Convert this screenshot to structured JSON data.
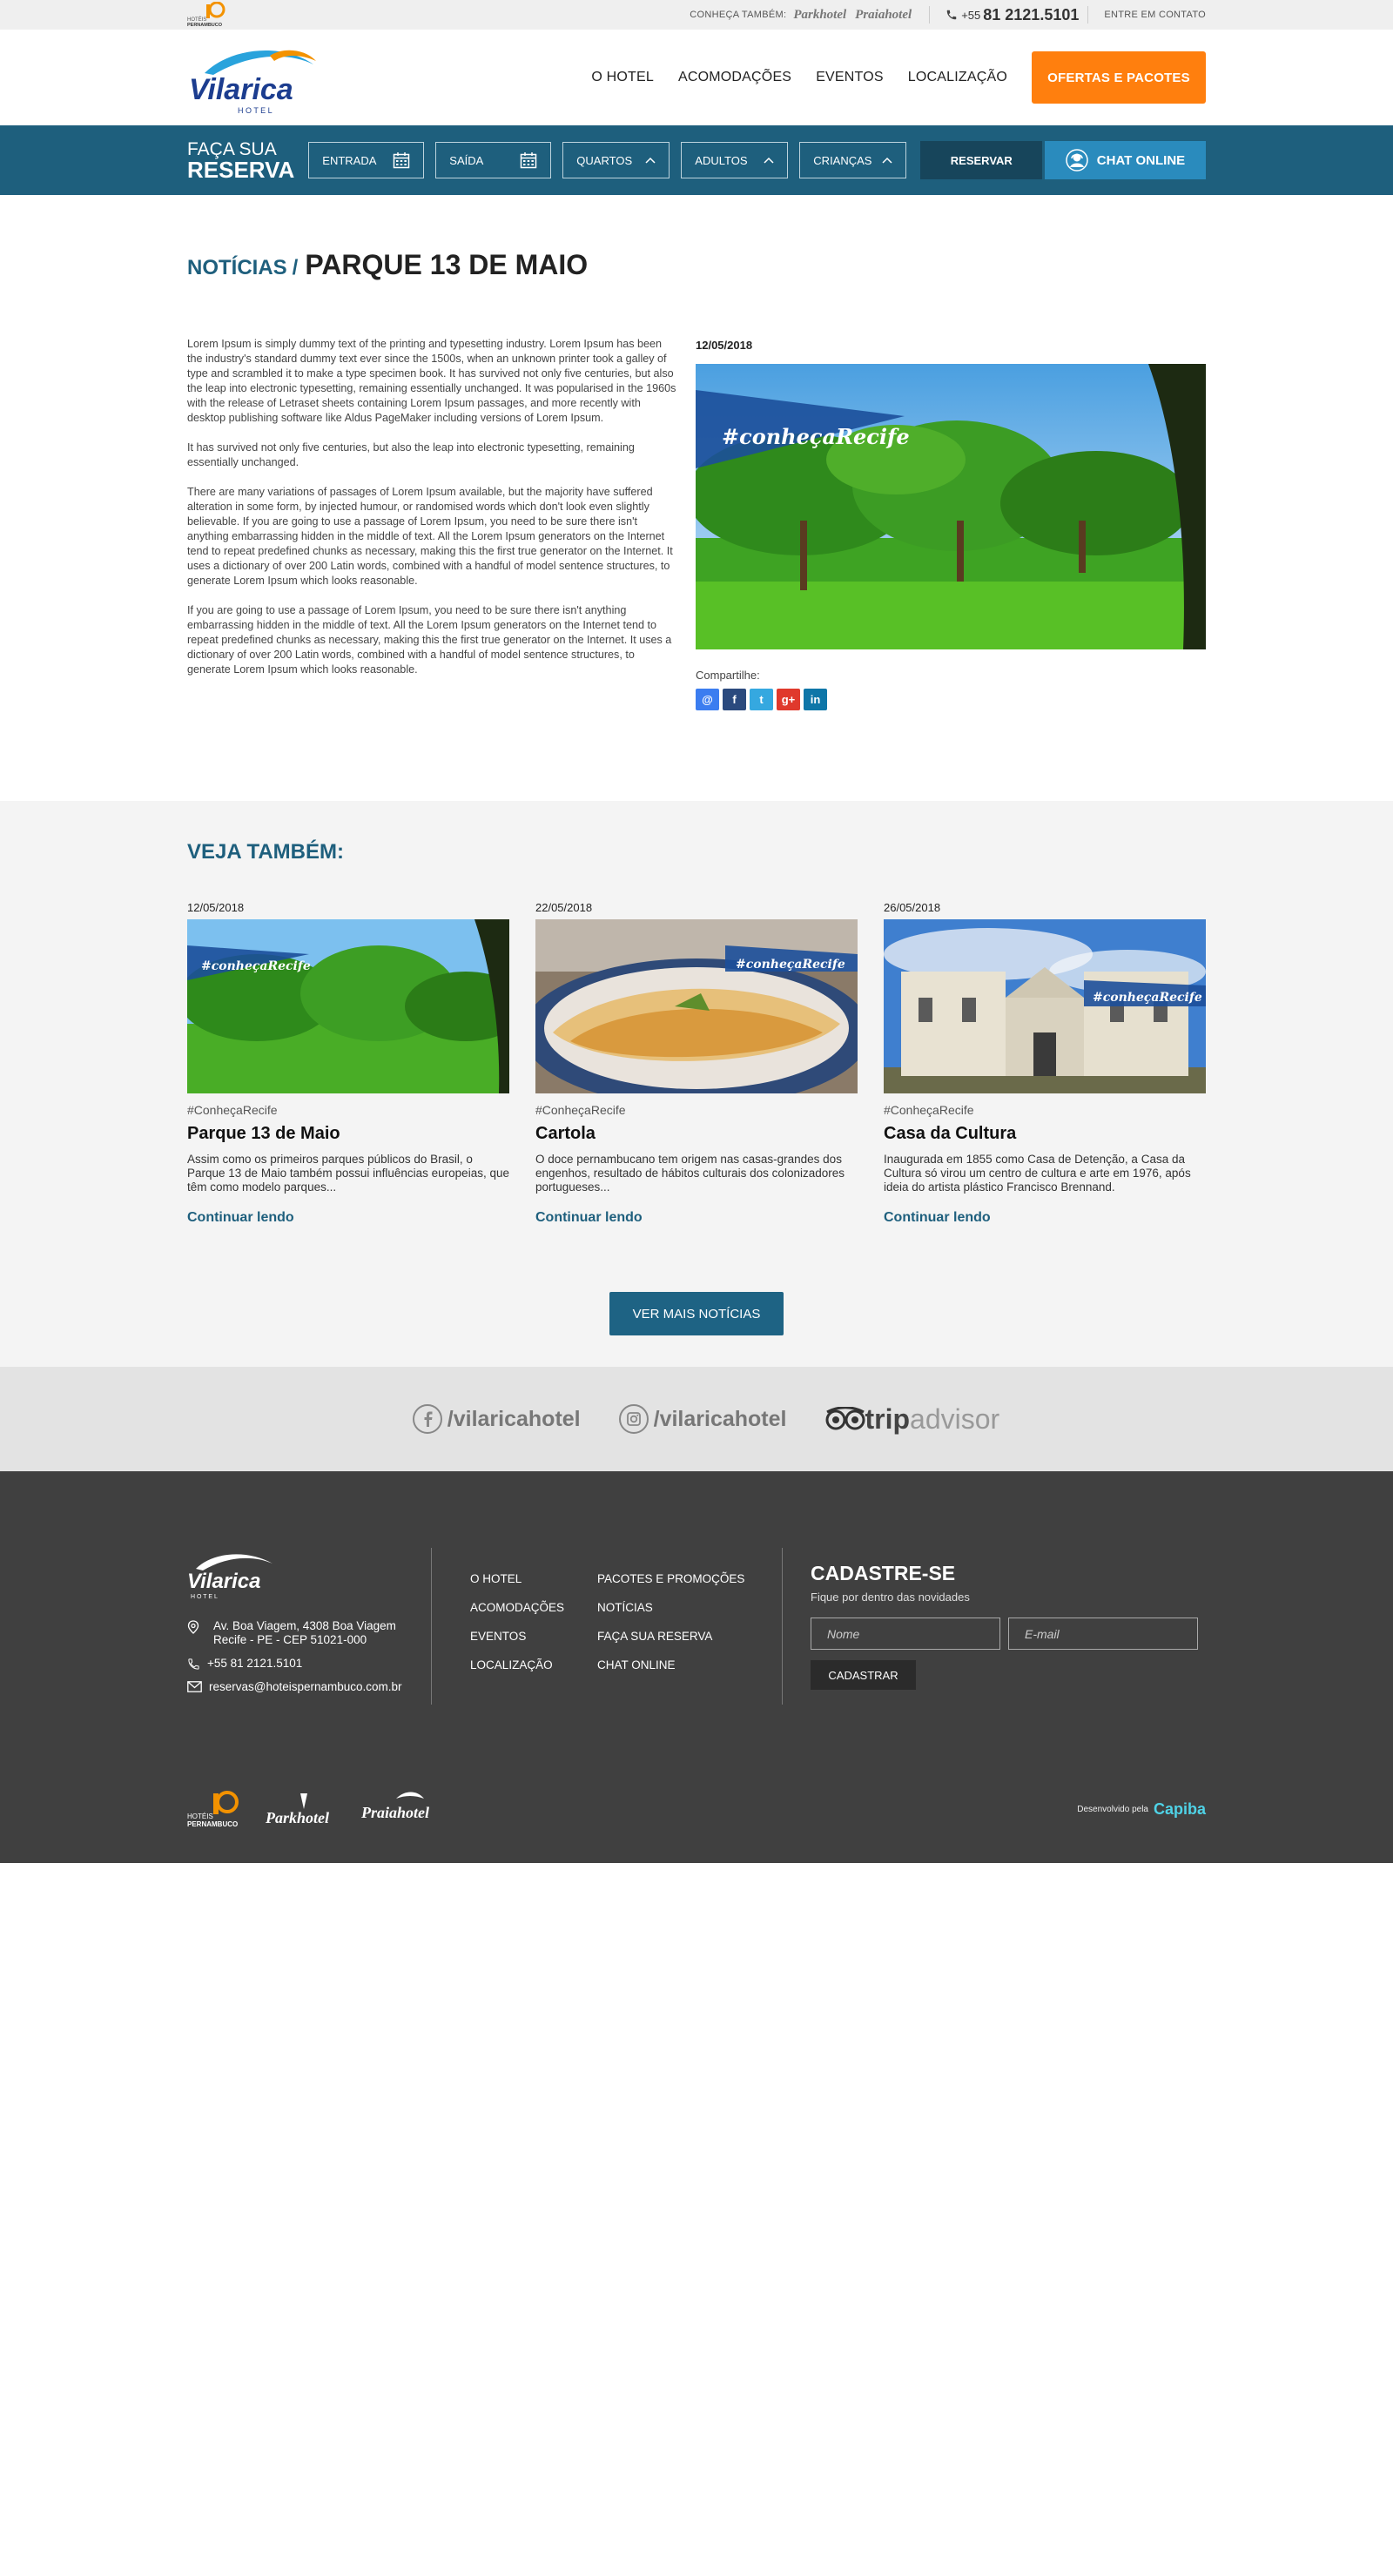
{
  "colors": {
    "brand_blue": "#1e5f7d",
    "accent_orange": "#ff7f0e",
    "chat_blue": "#2a8bbd",
    "footer_bg": "#404040"
  },
  "topbar": {
    "small_logo_line1": "HOTÉIS",
    "small_logo_line2": "PERNAMBUCO",
    "label": "CONHEÇA TAMBÉM:",
    "brand1": "Parkhotel",
    "brand2": "Praiahotel",
    "phone_prefix": "+55",
    "phone_number": "81 2121.5101",
    "contact": "ENTRE EM CONTATO"
  },
  "header": {
    "logo_name": "Vilarica",
    "logo_sub": "H O T E L",
    "nav": [
      "O HOTEL",
      "ACOMODAÇÕES",
      "EVENTOS",
      "LOCALIZAÇÃO"
    ],
    "cta": "OFERTAS E PACOTES"
  },
  "booking": {
    "title_line1": "FAÇA SUA",
    "title_line2": "RESERVA",
    "checkin": "ENTRADA",
    "checkout": "SAÍDA",
    "rooms": "QUARTOS",
    "adults": "ADULTOS",
    "children": "CRIANÇAS",
    "reserve": "RESERVAR",
    "chat": "CHAT ONLINE"
  },
  "article": {
    "breadcrumb_parent": "NOTÍCIAS",
    "breadcrumb_slash": "/",
    "title": "PARQUE 13 DE MAIO",
    "date": "12/05/2018",
    "image_tag": "#conheçaRecife",
    "paragraphs": [
      "Lorem Ipsum is simply dummy text of the printing and typesetting industry. Lorem Ipsum has been the industry's standard dummy text ever since the 1500s, when an unknown printer took a galley of type and scrambled it to make a type specimen book. It has survived not only five centuries, but also the leap into electronic typesetting, remaining essentially unchanged. It was popularised in the 1960s with the release of Letraset sheets containing Lorem Ipsum passages, and more recently with desktop publishing software like Aldus PageMaker including versions of Lorem Ipsum.",
      "It has survived not only five centuries, but also the leap into electronic typesetting, remaining essentially unchanged.",
      "There are many variations of passages of Lorem Ipsum available, but the majority have suffered alteration in some form, by injected humour, or randomised words which don't look even slightly believable. If you are going to use a passage of Lorem Ipsum, you need to be sure there isn't anything embarrassing hidden in the middle of text. All the Lorem Ipsum generators on the Internet tend to repeat predefined chunks as necessary, making this the first true generator on the Internet. It uses a dictionary of over 200 Latin words, combined with a handful of model sentence structures, to generate Lorem Ipsum which looks reasonable.",
      "If you are going to use a passage of Lorem Ipsum, you need to be sure there isn't anything embarrassing hidden in the middle of text. All the Lorem Ipsum generators on the Internet tend to repeat predefined chunks as necessary, making this the first true generator on the Internet. It uses a dictionary of over 200 Latin words, combined with a handful of model sentence structures, to generate Lorem Ipsum which looks reasonable."
    ],
    "share_label": "Compartilhe:",
    "share_icons": [
      "@",
      "f",
      "t",
      "g+",
      "in"
    ]
  },
  "see_also": {
    "title": "VEJA TAMBÉM:",
    "read_more": "Continuar lendo",
    "more_button": "VER MAIS NOTÍCIAS",
    "cards": [
      {
        "date": "12/05/2018",
        "img_tag": "#conheçaRecife",
        "tag": "#ConheçaRecife",
        "title": "Parque 13 de Maio",
        "text": "Assim como os primeiros parques públicos do Brasil, o Parque 13 de Maio também possui influências europeias, que têm como modelo parques..."
      },
      {
        "date": "22/05/2018",
        "img_tag": "#conheçaRecife",
        "tag": "#ConheçaRecife",
        "title": "Cartola",
        "text": "O doce pernambucano tem origem nas casas-grandes dos engenhos, resultado de hábitos culturais dos colonizadores portugueses..."
      },
      {
        "date": "26/05/2018",
        "img_tag": "#conheçaRecife",
        "tag": "#ConheçaRecife",
        "title": "Casa da Cultura",
        "text": "Inaugurada em 1855 como Casa de Detenção, a Casa da Cultura só virou um centro de cultura e arte em 1976, após ideia do artista plástico Francisco Brennand."
      }
    ]
  },
  "social": {
    "facebook": "/vilaricahotel",
    "instagram": "/vilaricahotel",
    "trip_bold": "trip",
    "trip_light": "advisor"
  },
  "footer": {
    "logo_name": "Vilarica",
    "logo_sub": "H O T E L",
    "address_line1": "Av. Boa Viagem, 4308 Boa Viagem",
    "address_line2": "Recife - PE - CEP 51021-000",
    "phone": "+55 81 2121.5101",
    "email": "reservas@hoteispernambuco.com.br",
    "links": [
      "O HOTEL",
      "PACOTES E PROMOÇÕES",
      "ACOMODAÇÕES",
      "NOTÍCIAS",
      "EVENTOS",
      "FAÇA SUA RESERVA",
      "LOCALIZAÇÃO",
      "CHAT ONLINE"
    ],
    "newsletter_title": "CADASTRE-SE",
    "newsletter_sub": "Fique por dentro das novidades",
    "name_placeholder": "Nome",
    "email_placeholder": "E-mail",
    "subscribe": "CADASTRAR",
    "brand1_line1": "HOTÉIS",
    "brand1_line2": "PERNAMBUCO",
    "brand2": "Parkhotel",
    "brand3": "Praiahotel",
    "dev_label": "Desenvolvido pela",
    "dev_name": "Capiba"
  }
}
